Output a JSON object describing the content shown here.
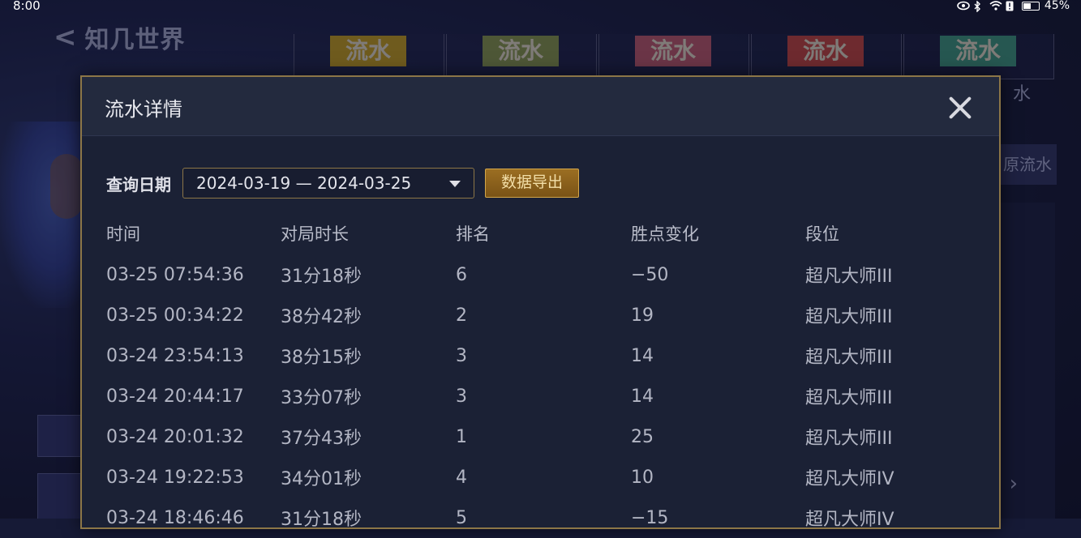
{
  "status": {
    "time": "8:00",
    "battery": "45%"
  },
  "app": {
    "title": "知几世界"
  },
  "background": {
    "tabs": [
      {
        "badge": "流水",
        "color": "#c9a11a"
      },
      {
        "badge": "流水",
        "color": "#8a9a4a"
      },
      {
        "badge": "流水",
        "color": "#c2596a"
      },
      {
        "badge": "流水",
        "color": "#c8453c"
      },
      {
        "badge": "流水",
        "color": "#3f9a7e"
      }
    ],
    "tab_side_text": "水",
    "side_pill": "原流水"
  },
  "modal": {
    "title": "流水详情",
    "query_label": "查询日期",
    "date_range": "2024-03-19 — 2024-03-25",
    "export_label": "数据导出",
    "accent": "#8c7647"
  },
  "table": {
    "headers": [
      "时间",
      "对局时长",
      "排名",
      "胜点变化",
      "段位"
    ],
    "rows": [
      [
        "03-25 07:54:36",
        "31分18秒",
        "6",
        "−50",
        "超凡大师III"
      ],
      [
        "03-25 00:34:22",
        "38分42秒",
        "2",
        "19",
        "超凡大师III"
      ],
      [
        "03-24 23:54:13",
        "38分15秒",
        "3",
        "14",
        "超凡大师III"
      ],
      [
        "03-24 20:44:17",
        "33分07秒",
        "3",
        "14",
        "超凡大师III"
      ],
      [
        "03-24 20:01:32",
        "37分43秒",
        "1",
        "25",
        "超凡大师III"
      ],
      [
        "03-24 19:22:53",
        "34分01秒",
        "4",
        "10",
        "超凡大师IV"
      ],
      [
        "03-24 18:46:46",
        "31分18秒",
        "5",
        "−15",
        "超凡大师IV"
      ]
    ]
  }
}
